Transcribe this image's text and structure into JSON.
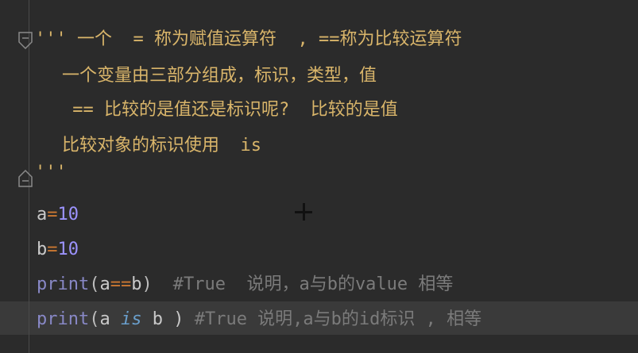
{
  "code": {
    "line1": {
      "quote": "'''",
      "text": " 一个  = 称为赋值运算符  , ==称为比较运算符"
    },
    "line2": {
      "text": "一个变量由三部分组成，标识，类型，值"
    },
    "line3": {
      "text": " == 比较的是值还是标识呢?  比较的是值"
    },
    "line4": {
      "text": "比较对象的标识使用  is"
    },
    "line5": {
      "quote": "'''"
    },
    "line6": {
      "var": "a",
      "op": "=",
      "num": "10"
    },
    "line7": {
      "var": "b",
      "op": "=",
      "num": "10"
    },
    "line8": {
      "fn": "print",
      "open": "(",
      "a": "a",
      "op": "==",
      "b": "b",
      "close": ")",
      "comment": "#True  说明，a与b的value 相等"
    },
    "line9": {
      "fn": "print",
      "open": "(",
      "a": "a ",
      "kw": "is",
      "b": " b )",
      "comment": " #True 说明,a与b的id标识 , 相等"
    }
  },
  "colors": {
    "background": "#2b2b2b",
    "docstring": "#d9b56a",
    "number": "#9c93ff",
    "operator": "#cc7832",
    "builtin": "#8888c6",
    "keyword": "#6a9fcc",
    "comment": "#7b7b7b"
  },
  "icons": [
    "fold-open-icon",
    "fold-close-icon",
    "crosshair-cursor-icon"
  ]
}
